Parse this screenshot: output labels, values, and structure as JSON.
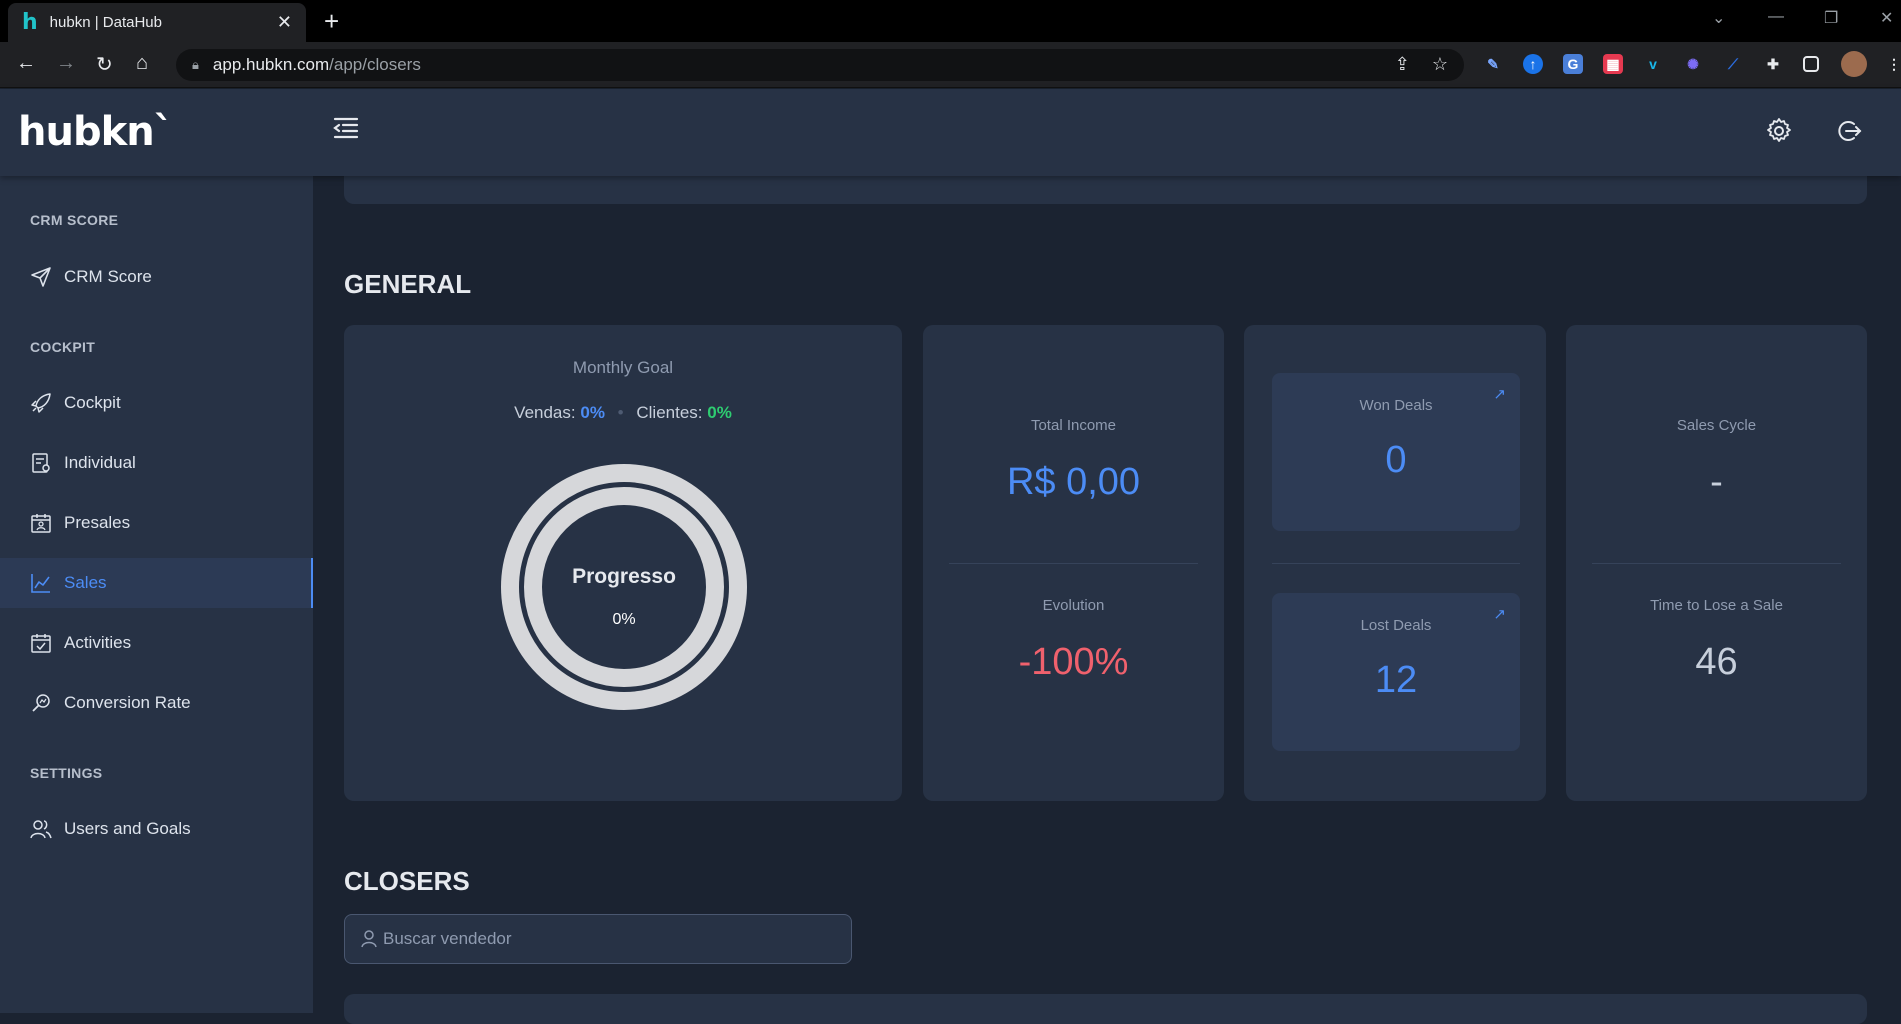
{
  "browser": {
    "tab_title": "hubkn | DataHub",
    "url_host": "app.hubkn.com",
    "url_path": "/app/closers"
  },
  "app": {
    "logo": "hubkn`"
  },
  "sidebar": {
    "sections": [
      {
        "title": "CRM SCORE",
        "items": [
          {
            "label": "CRM Score",
            "icon": "send-icon"
          }
        ]
      },
      {
        "title": "COCKPIT",
        "items": [
          {
            "label": "Cockpit",
            "icon": "rocket-icon"
          },
          {
            "label": "Individual",
            "icon": "report-icon"
          },
          {
            "label": "Presales",
            "icon": "calendar-user-icon"
          },
          {
            "label": "Sales",
            "icon": "chart-line-icon",
            "active": true
          },
          {
            "label": "Activities",
            "icon": "calendar-check-icon"
          },
          {
            "label": "Conversion Rate",
            "icon": "search-chart-icon"
          }
        ]
      },
      {
        "title": "SETTINGS",
        "items": [
          {
            "label": "Users and Goals",
            "icon": "users-icon"
          }
        ]
      }
    ]
  },
  "general": {
    "title": "GENERAL",
    "monthly_goal": {
      "title": "Monthly Goal",
      "vendas_label": "Vendas:",
      "vendas_value": "0%",
      "clientes_label": "Clientes:",
      "clientes_value": "0%",
      "gauge_title": "Progresso",
      "gauge_value": "0%",
      "progress": 0
    },
    "total_income": {
      "label": "Total Income",
      "value": "R$ 0,00"
    },
    "evolution": {
      "label": "Evolution",
      "value": "-100%"
    },
    "won_deals": {
      "label": "Won Deals",
      "value": "0"
    },
    "lost_deals": {
      "label": "Lost Deals",
      "value": "12"
    },
    "sales_cycle": {
      "label": "Sales Cycle",
      "value": "-"
    },
    "time_to_lose": {
      "label": "Time to Lose a Sale",
      "value": "46"
    }
  },
  "closers": {
    "title": "CLOSERS",
    "search_placeholder": "Buscar vendedor"
  },
  "colors": {
    "accent_blue": "#4c8cf5",
    "negative_red": "#f0616d",
    "positive_green": "#2ecc71",
    "panel": "#273245",
    "background": "#1b2331"
  }
}
